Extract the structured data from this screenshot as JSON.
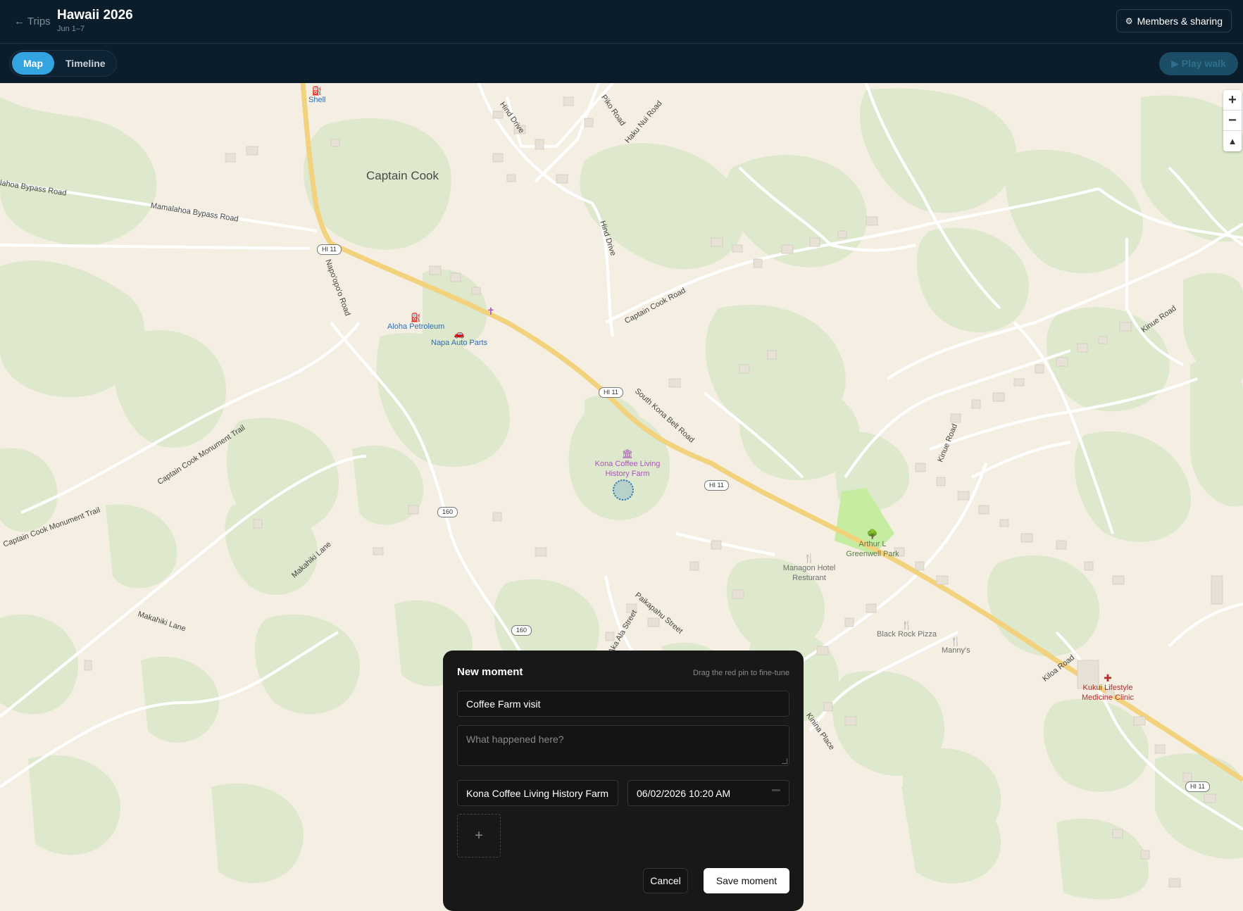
{
  "header": {
    "back_label": "← Trips",
    "trip_title": "Hawaii 2026",
    "trip_dates": "Jun 1–7",
    "share_label": "Members & sharing"
  },
  "toolbar": {
    "tabs": [
      {
        "label": "Map",
        "active": true
      },
      {
        "label": "Timeline",
        "active": false
      }
    ],
    "play_label": "▶ Play walk"
  },
  "map": {
    "town": "Captain Cook",
    "roads": {
      "mamalahoa_1": "lahoa Bypass Road",
      "mamalahoa_2": "Mamalahoa Bypass Road",
      "hind_drive_1": "Hind Drive",
      "hind_drive_2": "Hind Drive",
      "piko_road": "Piko Road",
      "haku_nui": "Haku Nui Road",
      "napoopoo": "Napo'opo'o Road",
      "captain_cook_road": "Captain Cook Road",
      "kinue_1": "Kinue Road",
      "kinue_2": "Kinue Road",
      "south_kona": "South Kona Belt Road",
      "monument_1": "Captain Cook Monument Trail",
      "monument_2": "Captain Cook Monument Trail",
      "makahiki_1": "Makahiki Lane",
      "makahiki_2": "Makahiki Lane",
      "paikapahu": "Paikapahu Street",
      "aka_ala": "Aka Ala Street",
      "kiloa": "Kiloa Road",
      "kinina": "Kinina Place"
    },
    "shields": {
      "hi11_a": "HI 11",
      "hi11_b": "HI 11",
      "hi11_c": "HI 11",
      "hi11_d": "HI 11",
      "r160_a": "160",
      "r160_b": "160"
    },
    "pois": {
      "shell": "Shell",
      "aloha": "Aloha Petroleum",
      "napa": "Napa Auto Parts",
      "kona_coffee": "Kona Coffee Living History Farm",
      "park": "Arthur L Greenwell Park",
      "managon": "Managon Hotel Resturant",
      "black_rock": "Black Rock Pizza",
      "mannys": "Manny's",
      "kukui": "Kukui Lifestyle Medicine Clinic"
    },
    "zoom_in": "+",
    "zoom_out": "−",
    "compass": "▲"
  },
  "moment_form": {
    "title": "New moment",
    "hint": "Drag the red pin to fine-tune",
    "name_value": "Coffee Farm visit",
    "notes_placeholder": "What happened here?",
    "place_value": "Kona Coffee Living History Farm",
    "datetime_value": "06/02/2026 10:20 AM",
    "add_photo": "+",
    "cancel_label": "Cancel",
    "save_label": "Save moment"
  }
}
